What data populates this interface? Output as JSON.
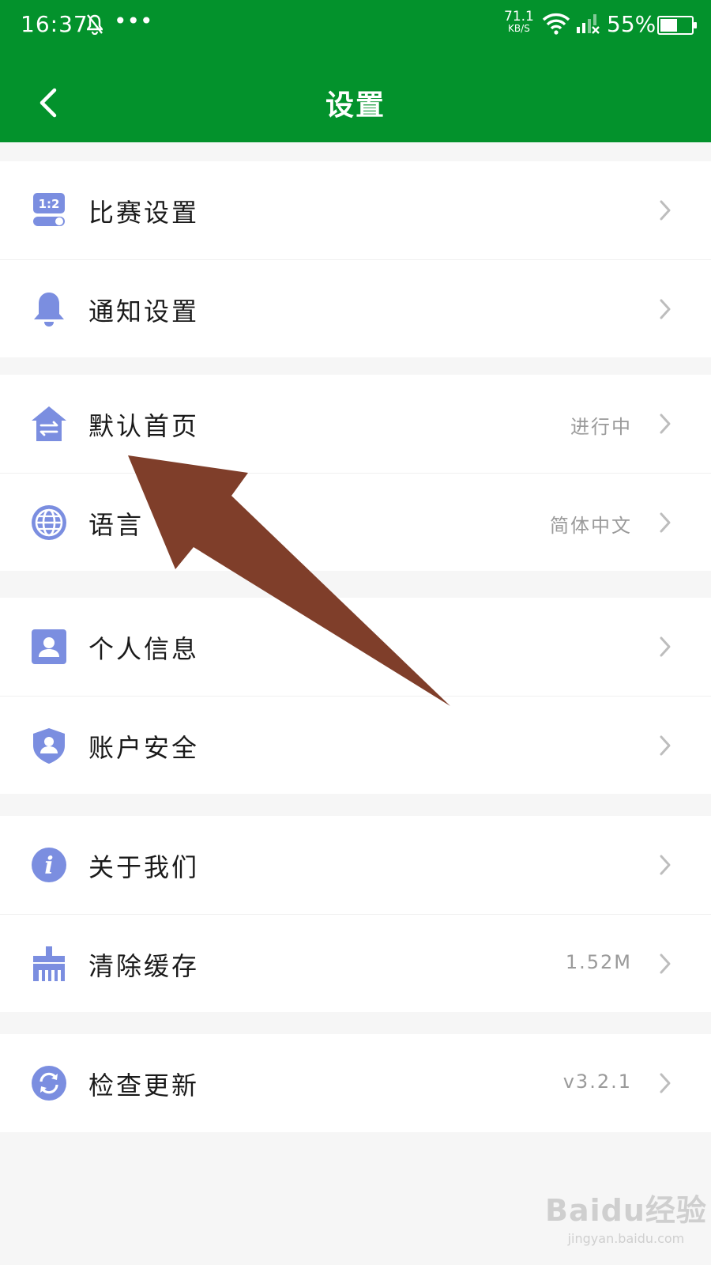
{
  "status_bar": {
    "time": "16:37",
    "dots": "•••",
    "net_speed": "71.1",
    "net_speed_unit": "KB/S",
    "battery_pct": "55%",
    "battery_level": 0.55
  },
  "header": {
    "title": "设置",
    "background_color": "#03922c"
  },
  "icon_color": "#7b8ee0",
  "groups": [
    {
      "items": [
        {
          "label": "比赛设置",
          "value": "",
          "icon": "match-score-icon"
        },
        {
          "label": "通知设置",
          "value": "",
          "icon": "bell-icon"
        }
      ]
    },
    {
      "items": [
        {
          "label": "默认首页",
          "value": "进行中",
          "icon": "home-switch-icon"
        },
        {
          "label": "语言",
          "value": "简体中文",
          "icon": "globe-icon"
        }
      ]
    },
    {
      "items": [
        {
          "label": "个人信息",
          "value": "",
          "icon": "user-card-icon"
        },
        {
          "label": "账户安全",
          "value": "",
          "icon": "shield-user-icon"
        }
      ]
    },
    {
      "items": [
        {
          "label": "关于我们",
          "value": "",
          "icon": "info-icon"
        },
        {
          "label": "清除缓存",
          "value": "1.52M",
          "icon": "broom-icon"
        }
      ]
    },
    {
      "items": [
        {
          "label": "检查更新",
          "value": "v3.2.1",
          "icon": "refresh-icon"
        }
      ]
    }
  ],
  "annotation_arrow_color": "#7f3e2a",
  "watermark": {
    "brand": "Baidu经验",
    "site": "jingyan.baidu.com"
  }
}
